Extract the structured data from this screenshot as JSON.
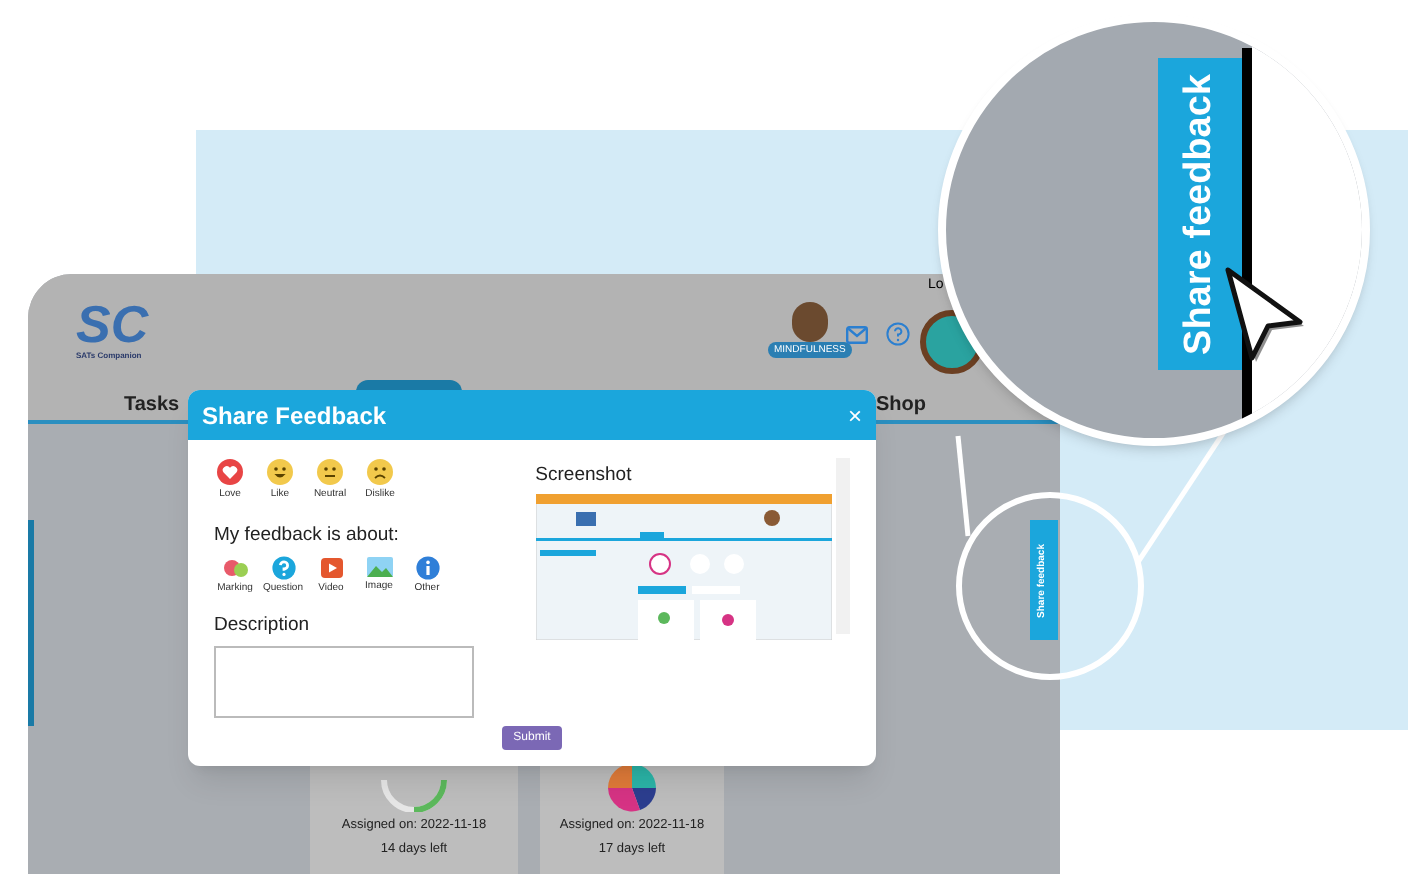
{
  "app": {
    "logo": {
      "mark": "SC",
      "name": "SATs Companion"
    },
    "badge": "MINDFULNESS",
    "account_link": "Lo",
    "nav": [
      {
        "label": "Tasks"
      },
      {
        "label": "Shop"
      }
    ]
  },
  "cards": [
    {
      "kind": "ring",
      "assigned": "Assigned on: 2022-11-18",
      "remaining": "14 days left"
    },
    {
      "kind": "pie",
      "assigned": "Assigned on: 2022-11-18",
      "remaining": "17 days left"
    }
  ],
  "dialog": {
    "title": "Share Feedback",
    "close": "×",
    "reactions": [
      {
        "label": "Love",
        "kind": "heart"
      },
      {
        "label": "Like",
        "kind": "smile"
      },
      {
        "label": "Neutral",
        "kind": "neutral"
      },
      {
        "label": "Dislike",
        "kind": "frown"
      }
    ],
    "about_heading": "My feedback is about:",
    "topics": [
      {
        "label": "Marking",
        "kind": "marking"
      },
      {
        "label": "Question",
        "kind": "question"
      },
      {
        "label": "Video",
        "kind": "video"
      },
      {
        "label": "Image",
        "kind": "image"
      },
      {
        "label": "Other",
        "kind": "info"
      }
    ],
    "description_label": "Description",
    "screenshot_label": "Screenshot",
    "submit": "Submit"
  },
  "feedback_tab": "Share feedback",
  "magnifier": {
    "feedback_tab": "Share feedback"
  }
}
